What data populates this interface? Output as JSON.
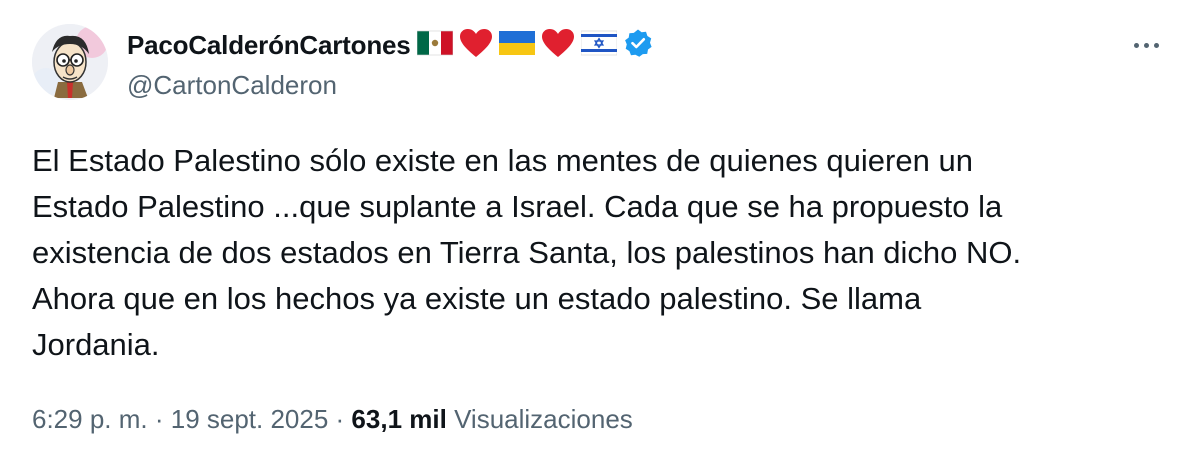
{
  "user": {
    "display_name": "PacoCalderónCartones",
    "handle": "@CartonCalderon",
    "name_emojis": [
      "flag-mexico-icon",
      "red-heart-icon",
      "flag-ukraine-icon",
      "red-heart-icon",
      "flag-israel-icon"
    ],
    "verified": true,
    "verified_color": "#1d9bf0"
  },
  "tweet": {
    "text": "El Estado Palestino sólo existe en las mentes de quienes quieren un\nEstado Palestino ...que suplante a Israel. Cada que se ha propuesto la\nexistencia de dos estados en Tierra Santa, los palestinos han dicho NO.\nAhora que en los hechos ya existe un estado palestino. Se llama\nJordania.",
    "time": "6:29 p. m.",
    "separator": " · ",
    "date": "19 sept. 2025",
    "views_count": "63,1 mil",
    "views_label": "Visualizaciones"
  }
}
